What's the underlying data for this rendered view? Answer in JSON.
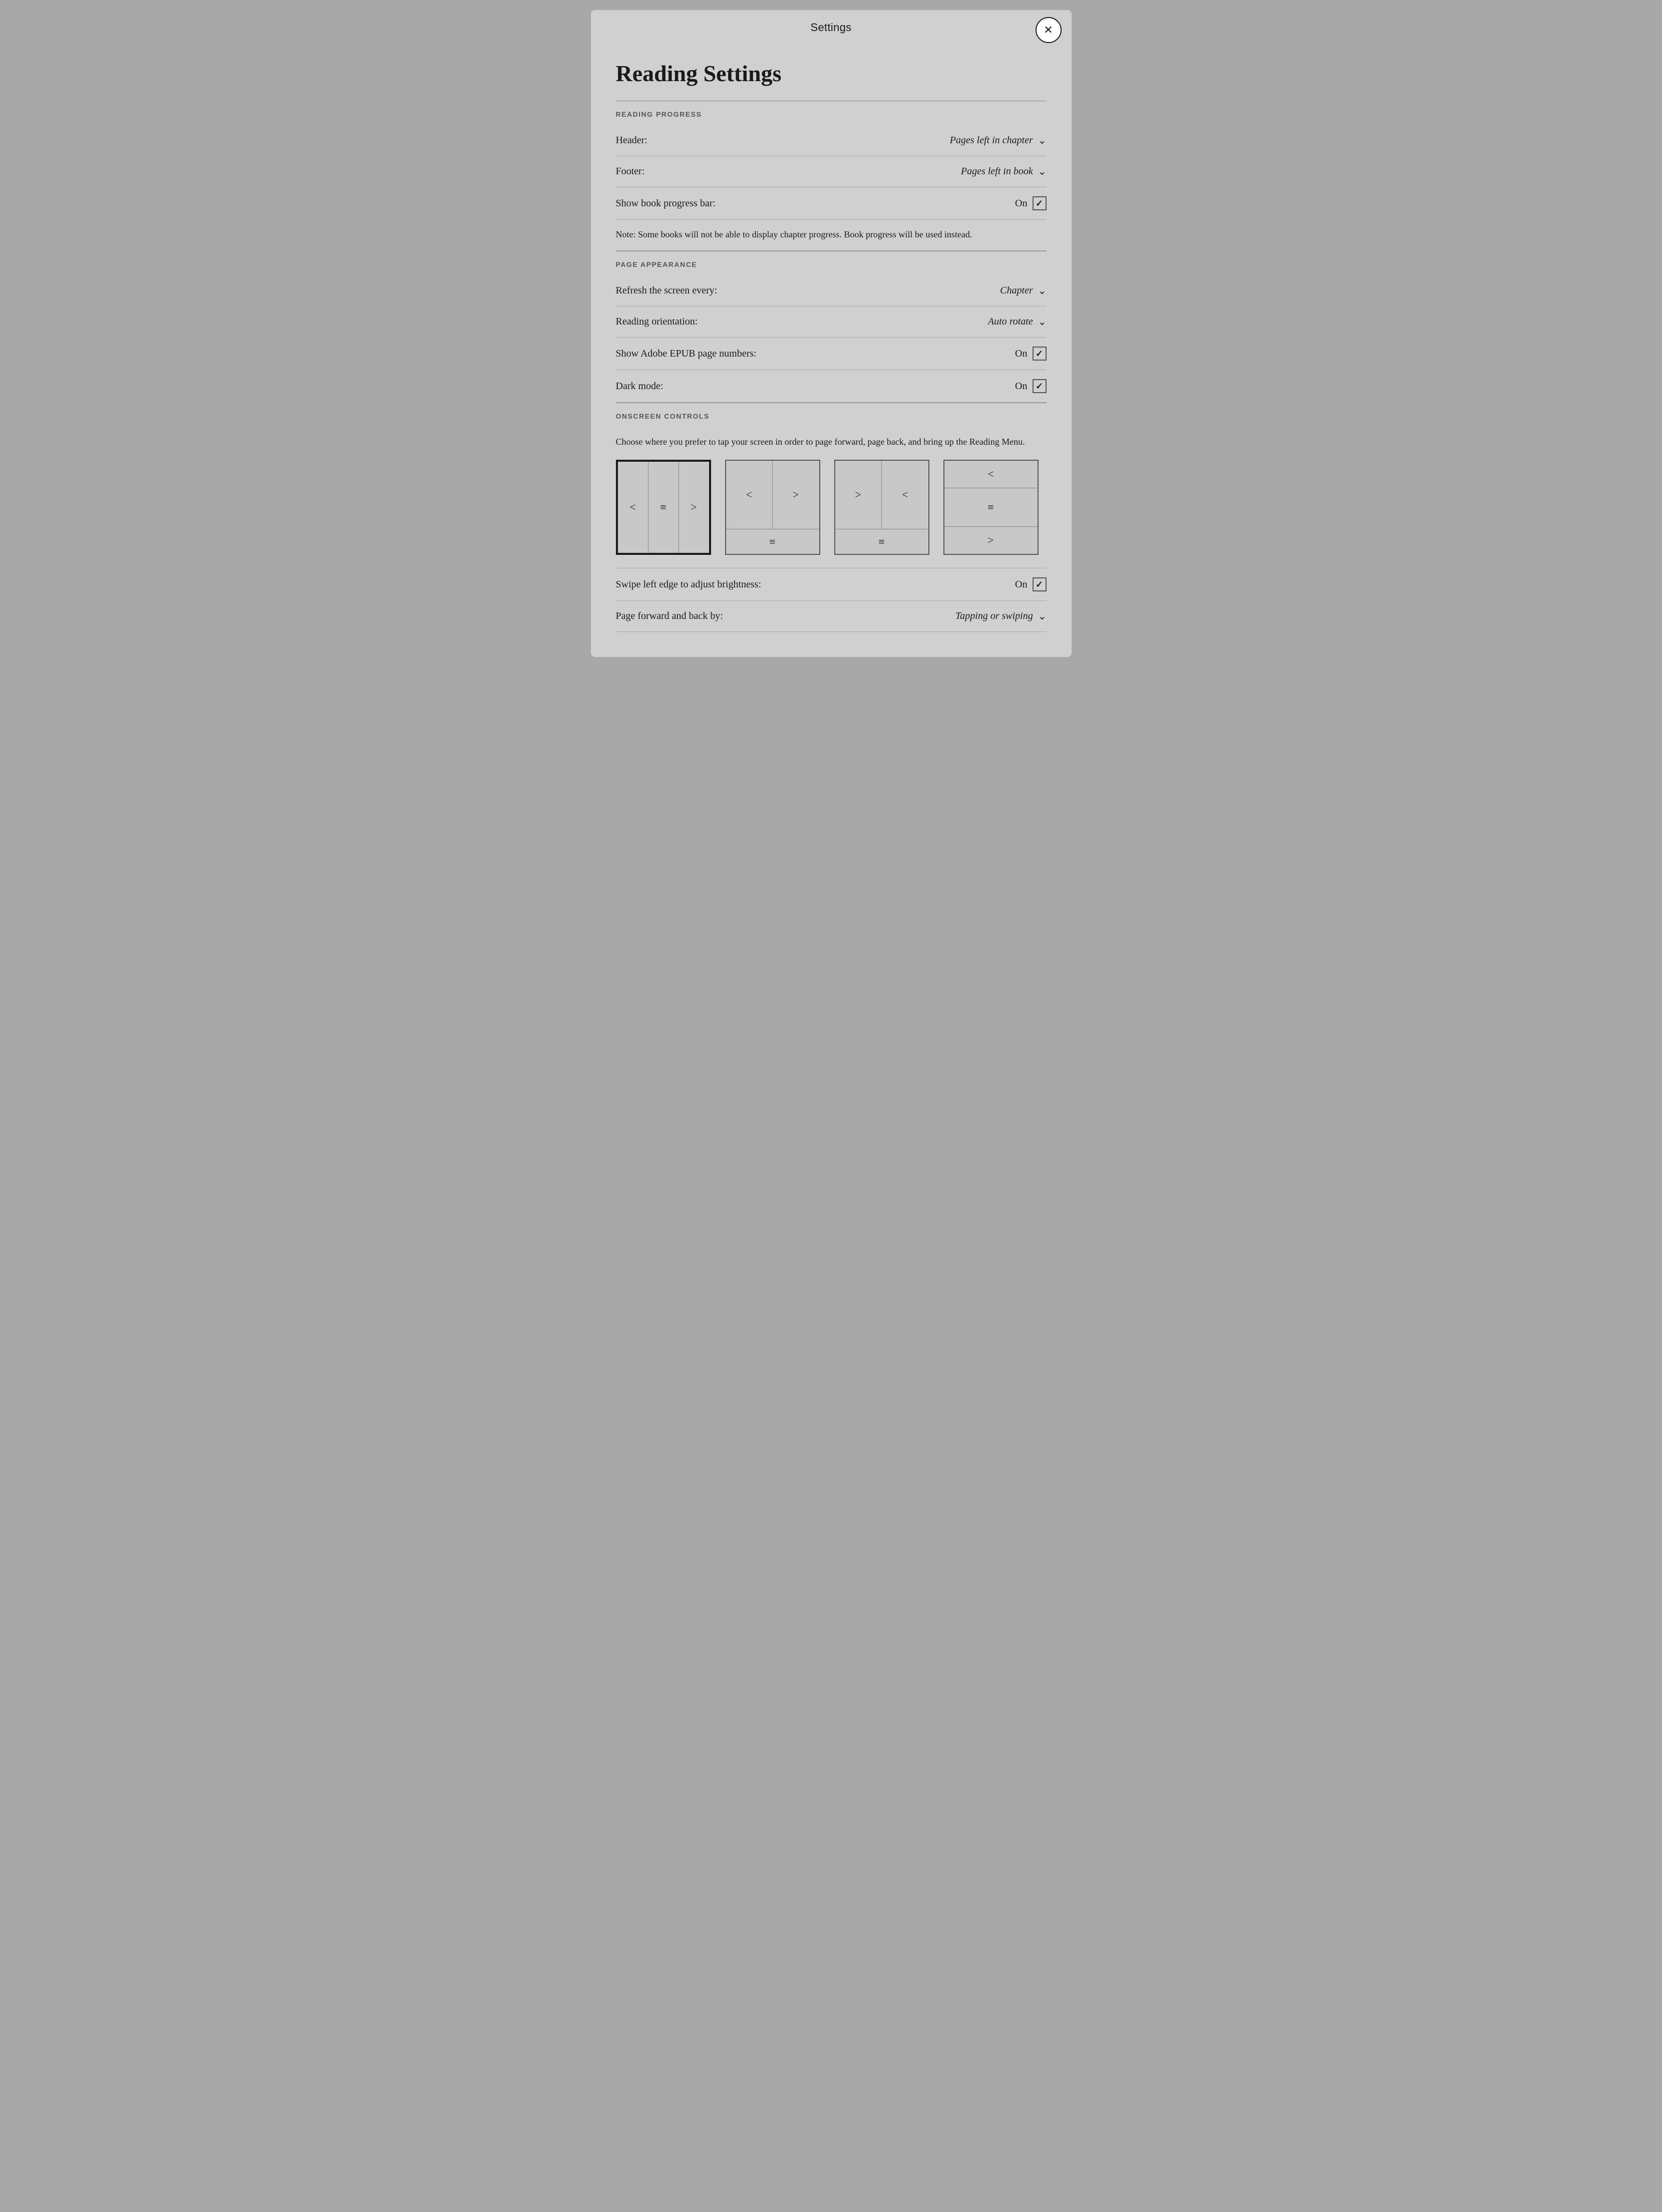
{
  "modal": {
    "title": "Settings",
    "close_label": "✕"
  },
  "page": {
    "heading": "Reading Settings"
  },
  "sections": {
    "reading_progress": {
      "label": "READING PROGRESS",
      "header_label": "Header:",
      "header_value": "Pages left in chapter",
      "footer_label": "Footer:",
      "footer_value": "Pages left in book",
      "progress_bar_label": "Show book progress bar:",
      "progress_bar_state": "On",
      "progress_bar_checked": true,
      "note": "Note: Some books will not be able to display chapter progress. Book progress will be used instead."
    },
    "page_appearance": {
      "label": "PAGE APPEARANCE",
      "refresh_label": "Refresh the screen every:",
      "refresh_value": "Chapter",
      "orientation_label": "Reading orientation:",
      "orientation_value": "Auto rotate",
      "adobe_label": "Show Adobe EPUB page numbers:",
      "adobe_state": "On",
      "adobe_checked": true,
      "dark_mode_label": "Dark mode:",
      "dark_mode_state": "On",
      "dark_mode_checked": true
    },
    "onscreen_controls": {
      "label": "ONSCREEN CONTROLS",
      "description": "Choose where you prefer to tap your screen in order to page forward, page back, and bring up the Reading Menu.",
      "layouts": [
        {
          "id": "layout-1",
          "selected": true
        },
        {
          "id": "layout-2",
          "selected": false
        },
        {
          "id": "layout-3",
          "selected": false
        },
        {
          "id": "layout-4",
          "selected": false
        }
      ],
      "swipe_label": "Swipe left edge to adjust brightness:",
      "swipe_state": "On",
      "swipe_checked": true,
      "page_forward_label": "Page forward and back by:",
      "page_forward_value": "Tapping or swiping"
    }
  }
}
